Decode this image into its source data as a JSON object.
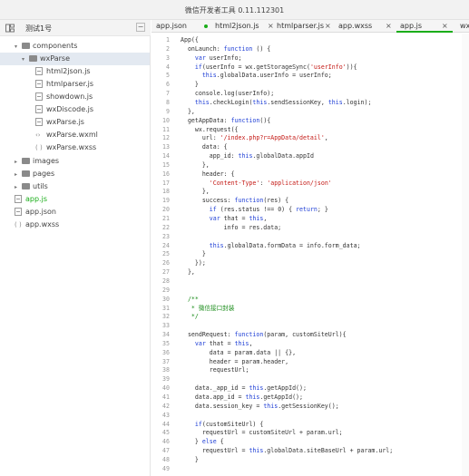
{
  "window": {
    "title": "微信开发者工具 0.11.112301"
  },
  "sidebar": {
    "project_name": "测试1号",
    "collapse_glyph": "−",
    "items": [
      {
        "label": "components",
        "kind": "folder",
        "expanded": true
      },
      {
        "label": "wxParse",
        "kind": "folder",
        "expanded": true,
        "selected": true
      },
      {
        "label": "html2json.js",
        "kind": "file"
      },
      {
        "label": "htmlparser.js",
        "kind": "file"
      },
      {
        "label": "showdown.js",
        "kind": "file"
      },
      {
        "label": "wxDiscode.js",
        "kind": "file"
      },
      {
        "label": "wxParse.js",
        "kind": "file"
      },
      {
        "label": "wxParse.wxml",
        "kind": "wxml",
        "glyph": "‹›"
      },
      {
        "label": "wxParse.wxss",
        "kind": "wxss",
        "glyph": "( )"
      },
      {
        "label": "images",
        "kind": "folder",
        "expanded": false
      },
      {
        "label": "pages",
        "kind": "folder",
        "expanded": false
      },
      {
        "label": "utils",
        "kind": "folder",
        "expanded": false
      },
      {
        "label": "app.js",
        "kind": "file",
        "active": true
      },
      {
        "label": "app.json",
        "kind": "file"
      },
      {
        "label": "app.wxss",
        "kind": "wxss",
        "glyph": "( )"
      }
    ]
  },
  "tabs": [
    {
      "label": "app.json",
      "close": ""
    },
    {
      "label": "html2json.js",
      "close": "×",
      "modified": true
    },
    {
      "label": "htmlparser.js",
      "close": "×"
    },
    {
      "label": "app.wxss",
      "close": "×"
    },
    {
      "label": "app.js",
      "close": "×",
      "active": true
    },
    {
      "label": "wx",
      "close": ""
    }
  ],
  "colors": {
    "accent": "#1aad19",
    "keyword": "#1f3fd6",
    "string": "#c41a16",
    "comment": "#1a8c1a"
  },
  "editor": {
    "lines": [
      "App({",
      "  onLaunch: function () {",
      "    var userInfo;",
      "    if(userInfo = wx.getStorageSync('userInfo')){",
      "      this.globalData.userInfo = userInfo;",
      "    }",
      "    console.log(userInfo);",
      "    this.checkLogin(this.sendSessionKey, this.login);",
      "  },",
      "  getAppData: function(){",
      "    wx.request({",
      "      url: '/index.php?r=AppData/detail',",
      "      data: {",
      "        app_id: this.globalData.appId",
      "      },",
      "      header: {",
      "        'Content-Type': 'application/json'",
      "      },",
      "      success: function(res) {",
      "        if (res.status !== 0) { return; }",
      "        var that = this,",
      "            info = res.data;",
      "",
      "        this.globalData.formData = info.form_data;",
      "      }",
      "    });",
      "  },",
      "",
      "",
      "  /**",
      "   * 微信接口封装",
      "   */",
      "",
      "  sendRequest: function(param, customSiteUrl){",
      "    var that = this,",
      "        data = param.data || {},",
      "        header = param.header,",
      "        requestUrl;",
      "",
      "    data._app_id = this.getAppId();",
      "    data.app_id = this.getAppId();",
      "    data.session_key = this.getSessionKey();",
      "",
      "    if(customSiteUrl) {",
      "      requestUrl = customSiteUrl + param.url;",
      "    } else {",
      "      requestUrl = this.globalData.siteBaseUrl + param.url;",
      "    }",
      ""
    ]
  }
}
